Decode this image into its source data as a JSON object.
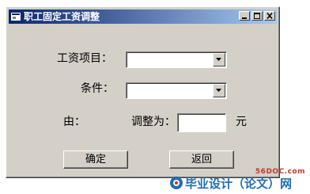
{
  "window": {
    "title": "职工固定工资调整",
    "controls": {
      "minimize": "minimize",
      "maximize": "maximize",
      "close": "close"
    }
  },
  "form": {
    "salary_item_label": "工资项目：",
    "salary_item_value": "",
    "condition_label": "条件：",
    "condition_value": "",
    "from_label": "由：",
    "adjust_label": "调整为：",
    "adjust_value": "",
    "unit_label": "元"
  },
  "buttons": {
    "ok": "确定",
    "back": "返回"
  },
  "watermark": {
    "site": "56DOC.com",
    "text": "毕业设计（论文）网"
  },
  "colors": {
    "window_bg": "#d4d0c8",
    "title_start": "#0a246a",
    "title_end": "#a6caf0",
    "watermark_blue": "#1f6fb2",
    "watermark_red": "#c0392b"
  }
}
